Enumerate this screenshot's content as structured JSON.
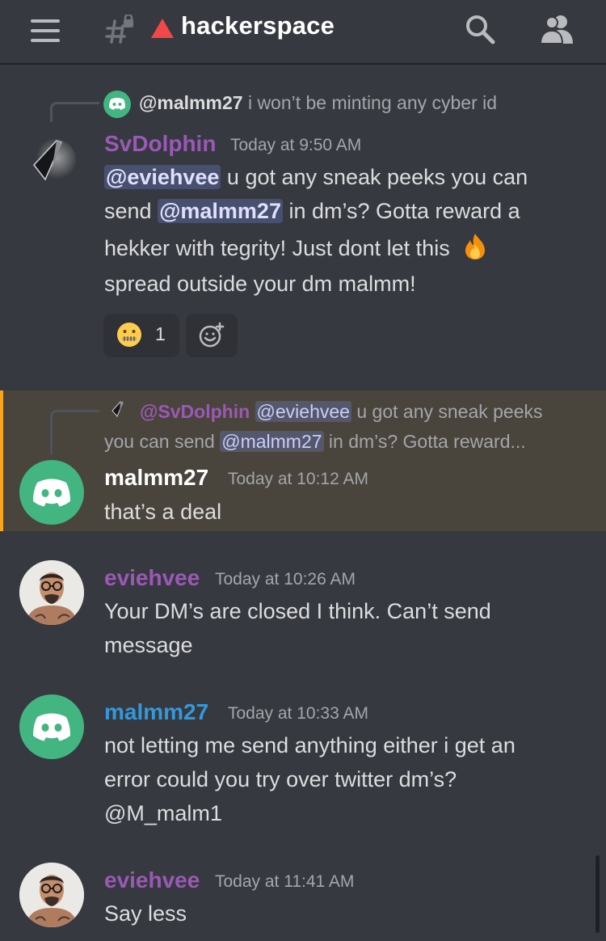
{
  "header": {
    "channel_name": "hackerspace",
    "icons": [
      "hamburger-menu-icon",
      "locked-hash-icon",
      "alert-triangle-icon",
      "search-icon",
      "members-icon"
    ]
  },
  "colors": {
    "background": "#36393f",
    "svdolphin_name": "#9b59b6",
    "malmm27_name_hl": "#ffffff",
    "eviehvee_name": "#9b59b6",
    "malmm27_name": "#3498db",
    "highlight_bg": "#49443c",
    "highlight_bar": "#faa61a",
    "alert": "#f04747"
  },
  "messages": [
    {
      "reply": {
        "author": "@malmm27",
        "text": "i won’t be minting any cyber id"
      },
      "author": "SvDolphin",
      "time": "Today at 9:50 AM",
      "line1_mention": "@eviehvee",
      "line1_text": " u got any sneak peeks you can",
      "line2_pre": "send ",
      "line2_mention": "@malmm27",
      "line2_text": " in dm’s? Gotta reward a",
      "line3": "hekker with tegrity! Just dont let this",
      "line4": "spread outside your dm malmm!",
      "reaction_emoji": "🤐",
      "reaction_count": "1"
    },
    {
      "reply": {
        "author": "@SvDolphin",
        "mention1": "@eviehvee",
        "text1": " u got any sneak peeks",
        "text2_pre": "you can send ",
        "mention2": "@malmm27",
        "text2_post": " in dm’s? Gotta reward..."
      },
      "author": "malmm27",
      "time": "Today at 10:12 AM",
      "text": "that’s a deal"
    },
    {
      "author": "eviehvee",
      "time": "Today at 10:26 AM",
      "line1": "Your DM’s are closed I think. Can’t send",
      "line2": "message"
    },
    {
      "author": "malmm27",
      "time": "Today at 10:33 AM",
      "line1": "not letting me send anything either i get an",
      "line2": "error could you try over twitter dm’s?",
      "line3": "@M_malm1"
    },
    {
      "author": "eviehvee",
      "time": "Today at 11:41 AM",
      "text": "Say less"
    }
  ]
}
